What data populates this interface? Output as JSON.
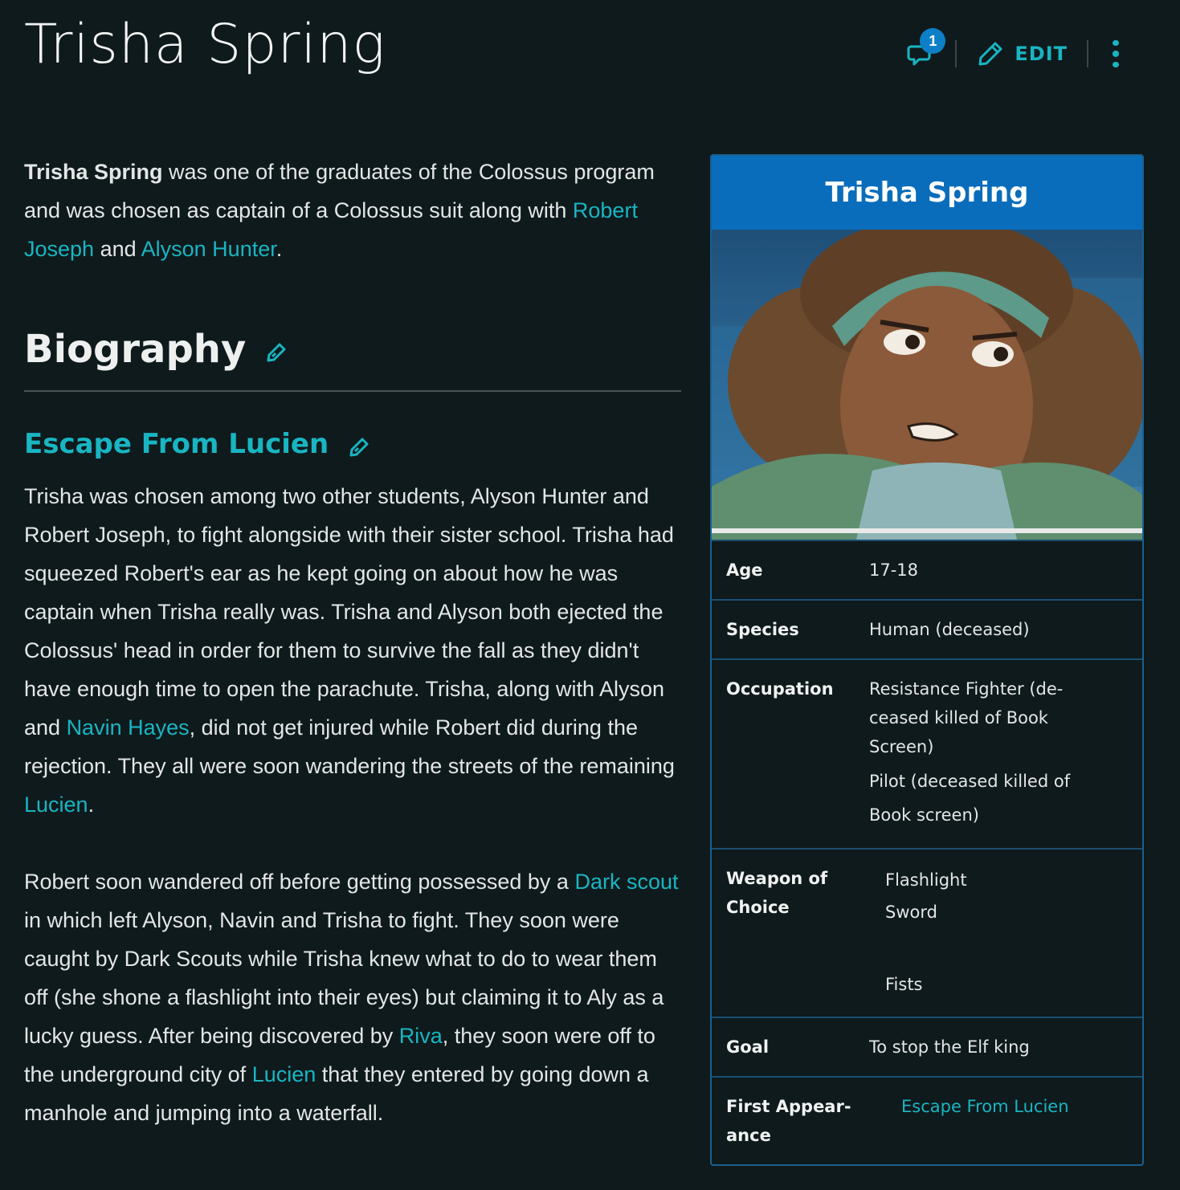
{
  "page": {
    "title": "Trisha Spring",
    "comment_count": "1",
    "edit_label": "EDIT"
  },
  "intro": {
    "bold": "Trisha Spring",
    "text1": " was one of the graduates of the Colossus program and was chosen as captain of a Colossus suit along with ",
    "link1": "Robert Joseph",
    "text2": " and ",
    "link2": "Alyson Hunter",
    "text3": "."
  },
  "biography": {
    "heading": "Biography",
    "subheading": "Escape From Lucien",
    "para1": {
      "text1": "Trisha was chosen among two other students, Alyson Hunter and Robert Joseph, to fight alongside with their sister school. Trisha had squeezed Robert's ear as he kept going on about how he was captain when Trisha really was. Trisha and Alyson both ejected the Colossus' head in order for them to survive the fall as they didn't have enough time to open the parachute. Trisha, along with Alyson and ",
      "link1": "Navin Hayes",
      "text2": ", did not get injured while Robert did during the rejection. They all were soon wandering the streets of the remaining ",
      "link2": "Lucien",
      "text3": "."
    },
    "para2": {
      "text1": "Robert soon wandered off before getting possessed by a ",
      "link1": "Dark scout",
      "text2": "  in which left Alyson, Navin and Trisha to fight. They soon were caught by Dark Scouts while Trisha knew what to do to wear them off (she shone a flashlight into their eyes) but claiming it to Aly as a lucky guess. After being discovered by ",
      "link2": "Riva",
      "text3": ", they soon were off to the underground city of ",
      "link3": "Lucien",
      "text4": "  that they entered by going down a manhole and jumping into a waterfall."
    }
  },
  "infobox": {
    "title": "Trisha Spring",
    "rows": {
      "age": {
        "label": "Age",
        "value": "17-18"
      },
      "species": {
        "label": "Species",
        "value": "Human (deceased)"
      },
      "occupation": {
        "label": "Occupation",
        "value1": "Resistance Fighter (de-ceased killed of Book Screen)",
        "value2": "Pilot (deceased killed of Book screen)"
      },
      "weapon": {
        "label": "Weapon of Choice",
        "value1": "Flashlight",
        "value2": "Sword",
        "value3": "Fists"
      },
      "goal": {
        "label": "Goal",
        "value": "To stop the Elf king"
      },
      "first": {
        "label": "First Appear-ance",
        "value": "Escape From Lucien"
      }
    }
  },
  "colors": {
    "background": "#0f1a1c",
    "link": "#19b5c2",
    "infobox_header": "#0a6dbb",
    "badge": "#0d7fc7"
  }
}
